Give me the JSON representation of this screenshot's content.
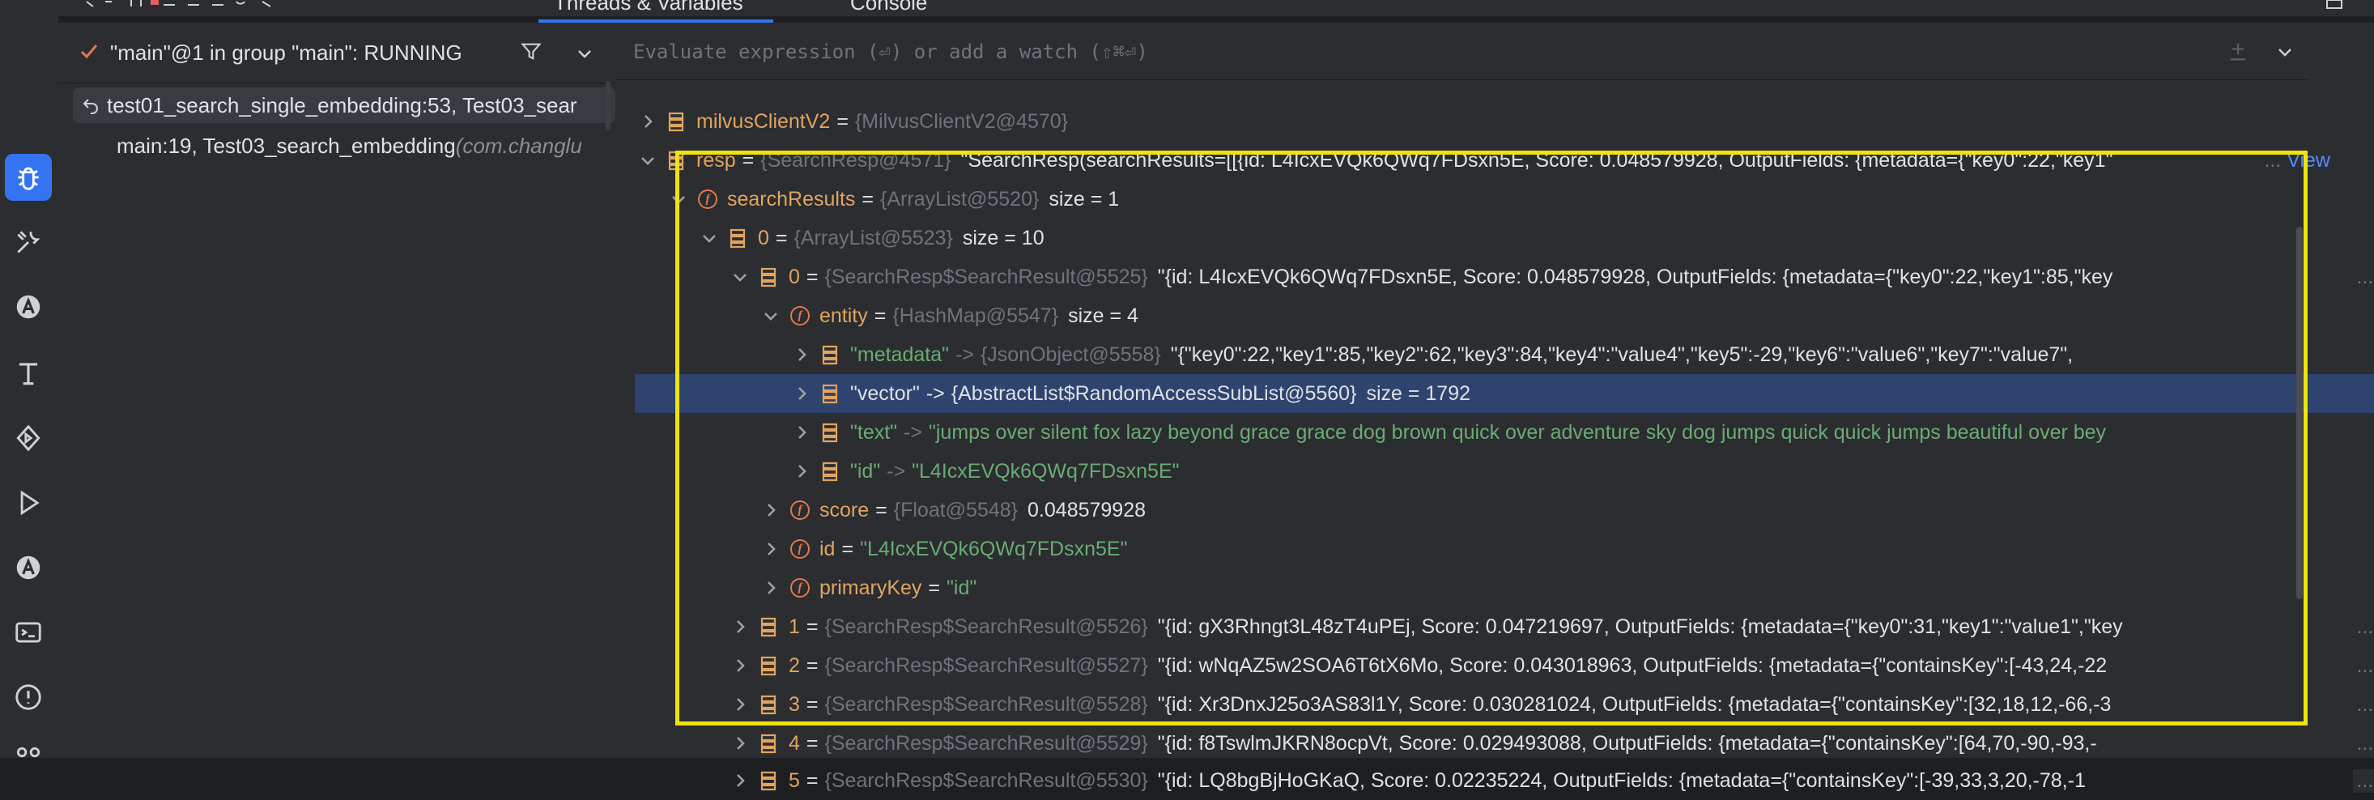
{
  "tabs": {
    "threads_variables": "Threads & Variables",
    "console": "Console"
  },
  "thread": {
    "label": "\"main\"@1 in group \"main\": RUNNING"
  },
  "frames": [
    {
      "text": "test01_search_single_embedding:53, Test03_sear",
      "pkg": ""
    },
    {
      "text": "main:19, Test03_search_embedding ",
      "pkg": "(com.changlu"
    }
  ],
  "eval": {
    "placeholder": "Evaluate expression (⏎) or add a watch (⇧⌘⏎)"
  },
  "view_label": "View",
  "variables": {
    "milvus": {
      "name": "milvusClientV2",
      "type": "{MilvusClientV2@4570}"
    },
    "resp": {
      "name": "resp",
      "type": "{SearchResp@4571}",
      "value": "\"SearchResp(searchResults=[[{id: L4IcxEVQk6QWq7FDsxn5E, Score: 0.048579928, OutputFields: {metadata={\"key0\":22,\"key1\"",
      "dots": "..."
    },
    "searchResults": {
      "name": "searchResults",
      "type": "{ArrayList@5520}",
      "value": "size = 1"
    },
    "list0": {
      "name": "0",
      "type": "{ArrayList@5523}",
      "value": "size = 10"
    },
    "item0": {
      "name": "0",
      "type": "{SearchResp$SearchResult@5525}",
      "value": "\"{id: L4IcxEVQk6QWq7FDsxn5E, Score: 0.048579928, OutputFields: {metadata={\"key0\":22,\"key1\":85,\"key",
      "dots": "..."
    },
    "entity": {
      "name": "entity",
      "type": "{HashMap@5547}",
      "value": "size = 4"
    },
    "metadata": {
      "name": "\"metadata\"",
      "arrow": "->",
      "type": "{JsonObject@5558}",
      "value": "\"{\"key0\":22,\"key1\":85,\"key2\":62,\"key3\":84,\"key4\":\"value4\",\"key5\":-29,\"key6\":\"value6\",\"key7\":\"value7\",",
      "dots": "..."
    },
    "vector": {
      "name": "\"vector\"",
      "arrow": "->",
      "type": "{AbstractList$RandomAccessSubList@5560}",
      "value": "size = 1792"
    },
    "text": {
      "name": "\"text\"",
      "arrow": "->",
      "value": "\"jumps over silent fox lazy beyond grace grace dog brown quick over adventure sky dog jumps quick quick jumps beautiful over bey",
      "dots": "..."
    },
    "id_entry": {
      "name": "\"id\"",
      "arrow": "->",
      "value": "\"L4IcxEVQk6QWq7FDsxn5E\""
    },
    "score": {
      "name": "score",
      "type": "{Float@5548}",
      "value": "0.048579928"
    },
    "id": {
      "name": "id",
      "value": "\"L4IcxEVQk6QWq7FDsxn5E\""
    },
    "primaryKey": {
      "name": "primaryKey",
      "value": "\"id\""
    },
    "item1": {
      "name": "1",
      "type": "{SearchResp$SearchResult@5526}",
      "value": "\"{id: gX3Rhngt3L48zT4uPEj, Score: 0.047219697, OutputFields: {metadata={\"key0\":31,\"key1\":\"value1\",\"key",
      "dots": "..."
    },
    "item2": {
      "name": "2",
      "type": "{SearchResp$SearchResult@5527}",
      "value": "\"{id: wNqAZ5w2SOA6T6tX6Mo, Score: 0.043018963, OutputFields: {metadata={\"containsKey\":[-43,24,-22",
      "dots": "..."
    },
    "item3": {
      "name": "3",
      "type": "{SearchResp$SearchResult@5528}",
      "value": "\"{id: Xr3DnxJ25o3AS83l1Y, Score: 0.030281024, OutputFields: {metadata={\"containsKey\":[32,18,12,-66,-3",
      "dots": "..."
    },
    "item4": {
      "name": "4",
      "type": "{SearchResp$SearchResult@5529}",
      "value": "\"{id: f8TswlmJKRN8ocpVt, Score: 0.029493088, OutputFields: {metadata={\"containsKey\":[64,70,-90,-93,-",
      "dots": "..."
    },
    "item5": {
      "name": "5",
      "type": "{SearchResp$SearchResult@5530}",
      "value": "\"{id: LQ8bgBjHoGKaQ, Score: 0.02235224, OutputFields: {metadata={\"containsKey\":[-39,33,3,20,-78,-1",
      "dots": "..."
    }
  },
  "colors": {
    "accent": "#3574f0",
    "highlight_box": "#f0e30e",
    "string": "#6aab73",
    "field_icon": "#e0794a"
  }
}
